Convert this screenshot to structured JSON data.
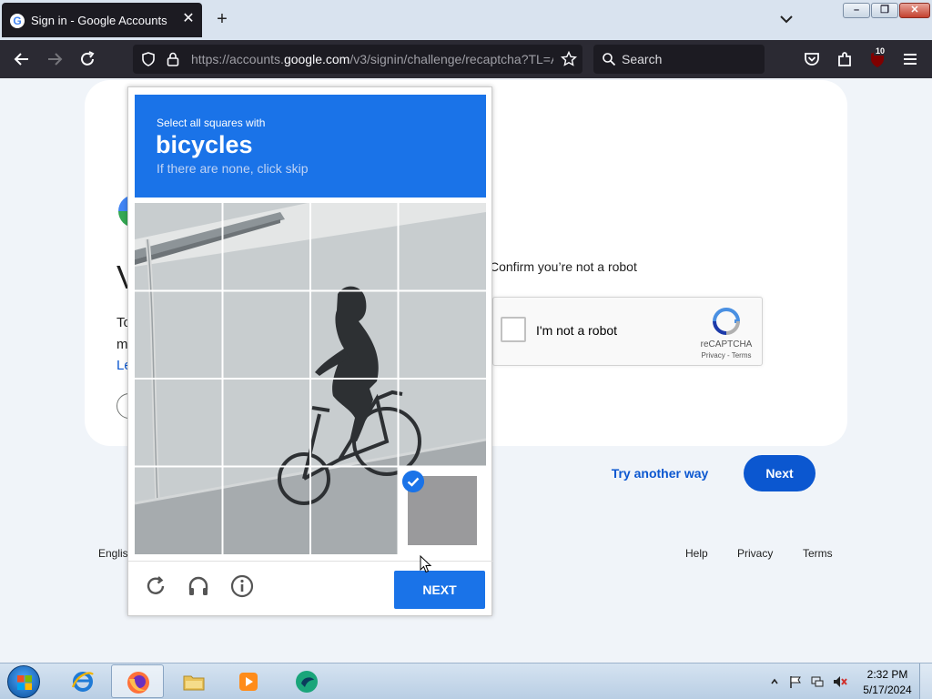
{
  "browser": {
    "tab_title": "Sign in - Google Accounts",
    "tab_favicon": "G",
    "tab_close": "✕",
    "new_tab": "+",
    "url_prefix": "https://accounts.",
    "url_domain": "google.com",
    "url_suffix": "/v3/signin/challenge/recaptcha?TL=A",
    "search_placeholder": "Search",
    "extension_badge": "10",
    "icons": [
      "back-icon",
      "forward-icon",
      "reload-icon",
      "shield-icon",
      "lock-icon",
      "star-icon",
      "search-icon",
      "pocket-icon",
      "extensions-icon",
      "ublock-icon",
      "menu-icon"
    ]
  },
  "window": {
    "minimize": "–",
    "maximize": "❐",
    "close": "✕"
  },
  "page": {
    "heading_partial": "V",
    "body_line1_partial": "To",
    "body_line2_partial": "m",
    "learn_partial": "Le",
    "robot_heading": "Confirm you’re not a robot",
    "recaptcha": {
      "label": "I'm not a robot",
      "brand": "reCAPTCHA",
      "links": "Privacy - Terms"
    },
    "try_another": "Try another way",
    "next": "Next",
    "language_partial": "Englis",
    "footer": {
      "help": "Help",
      "privacy": "Privacy",
      "terms": "Terms"
    }
  },
  "challenge": {
    "instruction": "Select all squares with",
    "object": "bicycles",
    "skip_hint": "If there are none, click skip",
    "grid_size": 4,
    "selected_tiles": [
      16
    ],
    "verify_label": "NEXT",
    "icons": [
      "reload-icon",
      "headphones-icon",
      "info-icon"
    ]
  },
  "taskbar": {
    "pinned": [
      "start-orb",
      "internet-explorer-icon",
      "firefox-icon",
      "file-explorer-icon",
      "media-player-icon",
      "app-icon"
    ],
    "time": "2:32 PM",
    "date": "5/17/2024"
  },
  "colors": {
    "challenge_blue": "#1a73e8",
    "google_blue": "#0b57d0",
    "toolbar": "#2b2a33"
  }
}
